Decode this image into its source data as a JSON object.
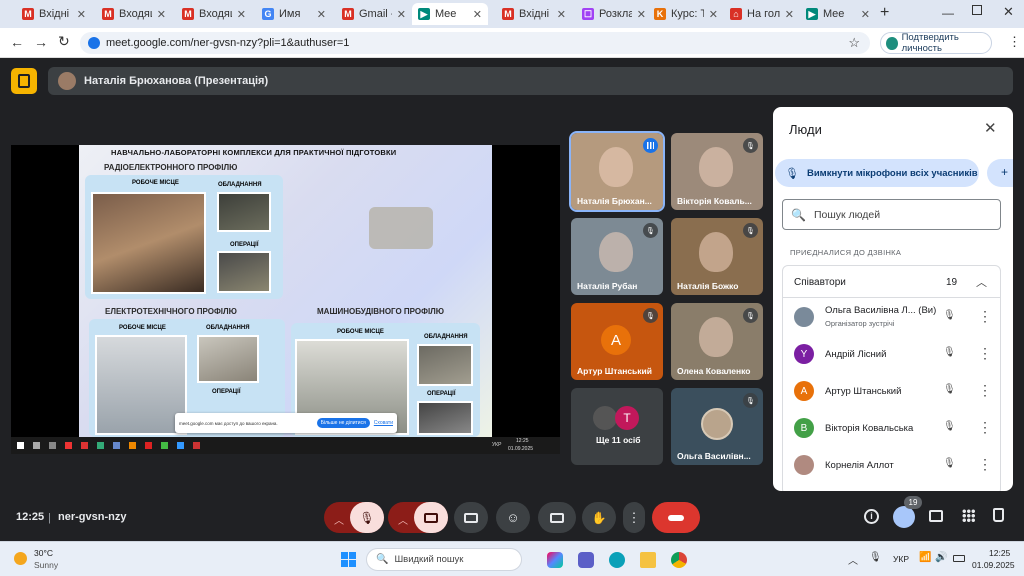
{
  "browser": {
    "tabs": [
      {
        "title": "Вхідні (2",
        "icon": "gmail-icon"
      },
      {
        "title": "Входящ",
        "icon": "gmail-icon"
      },
      {
        "title": "Входящ",
        "icon": "gmail-icon"
      },
      {
        "title": "Имя",
        "icon": "google-icon"
      },
      {
        "title": "Gmail -",
        "icon": "gmail-icon"
      },
      {
        "title": "Mee",
        "icon": "meet-icon"
      },
      {
        "title": "Вхідні (2",
        "icon": "gmail-icon"
      },
      {
        "title": "Розклад",
        "icon": "calendar-icon"
      },
      {
        "title": "Курс: Те",
        "icon": "course-icon"
      },
      {
        "title": "На голо",
        "icon": "home-icon"
      },
      {
        "title": "Mee",
        "icon": "meet-icon"
      }
    ],
    "new_tab": "+",
    "url": "meet.google.com/ner-gvsn-nzy?pli=1&authuser=1",
    "verify_label": "Подтвердить личность"
  },
  "meet": {
    "presenter_label": "Наталія Брюханова (Презентація)",
    "slide": {
      "title": "НАВЧАЛЬНО-ЛАБОРАТОРНІ КОМПЛЕКСИ ДЛЯ ПРАКТИЧНОЇ ПІДГОТОВКИ",
      "sections": [
        {
          "heading": "РАДІОЕЛЕКТРОННОГО ПРОФІЛЮ",
          "labels": [
            "РОБОЧЕ МІСЦЕ",
            "ОБЛАДНАННЯ",
            "ОПЕРАЦІЇ"
          ]
        },
        {
          "heading": "ЕЛЕКТРОТЕХНІЧНОГО ПРОФІЛЮ",
          "labels": [
            "РОБОЧЕ МІСЦЕ",
            "ОБЛАДНАННЯ",
            "ОПЕРАЦІЇ"
          ]
        },
        {
          "heading": "МАШИНОБУДІВНОГО ПРОФІЛЮ",
          "labels": [
            "РОБОЧЕ МІСЦЕ",
            "ОБЛАДНАННЯ",
            "ОПЕРАЦІЇ"
          ]
        }
      ],
      "share_bar": {
        "text": "meet.google.com має доступ до вашого екрана.",
        "stop": "Більше не ділитися",
        "hide": "Сховати"
      },
      "inner_taskbar": {
        "lang": "УКР",
        "time": "12:25",
        "date": "01.09.2025"
      }
    },
    "tiles": [
      {
        "name": "Наталія Брюхан...",
        "bg": "#b59a7e",
        "speaking": true
      },
      {
        "name": "Вікторія Коваль...",
        "bg": "#9c8a7a",
        "speaking": false
      },
      {
        "name": "Наталія Рубан",
        "bg": "#7d8a94",
        "speaking": false
      },
      {
        "name": "Наталія Божко",
        "bg": "#8a6e4f",
        "speaking": false
      },
      {
        "name": "Артур Штанський",
        "bg": "#c6560f",
        "initial": "А",
        "speaking": false
      },
      {
        "name": "Олена Коваленко",
        "bg": "#8a7d6a",
        "speaking": false
      },
      {
        "name": "Ще 11 осіб",
        "bg": "#3c4043",
        "initial": "T",
        "speaking": false
      },
      {
        "name": "Ольга Василівн...",
        "bg": "#3b4f5d",
        "speaking": false
      }
    ],
    "people_panel": {
      "title": "Люди",
      "mute_all": "Вимкнути мікрофони всіх учасників",
      "search_placeholder": "Пошук людей",
      "joined_label": "ПРИЄДНАЛИСЯ ДО ДЗВІНКА",
      "group_name": "Співавтори",
      "group_count": "19",
      "people": [
        {
          "name": "Ольга Василівна Л... (Ви)",
          "sub": "Організатор зустрічі",
          "color": "#7a8a9a",
          "initial": ""
        },
        {
          "name": "Андрій Лісний",
          "sub": "",
          "color": "#7b1fa2",
          "initial": "Y"
        },
        {
          "name": "Артур Штанський",
          "sub": "",
          "color": "#e8710a",
          "initial": "А"
        },
        {
          "name": "Вікторія Ковальська",
          "sub": "",
          "color": "#43a047",
          "initial": "В"
        },
        {
          "name": "Корнелія Аллот",
          "sub": "",
          "color": "#b08a80",
          "initial": ""
        }
      ]
    },
    "bottom": {
      "time": "12:25",
      "meeting_code": "ner-gvsn-nzy",
      "people_count": "19"
    }
  },
  "taskbar": {
    "weather_temp": "30°C",
    "weather_text": "Sunny",
    "search_placeholder": "Швидкий пошук",
    "lang": "УКР",
    "time": "12:25",
    "date": "01.09.2025"
  }
}
